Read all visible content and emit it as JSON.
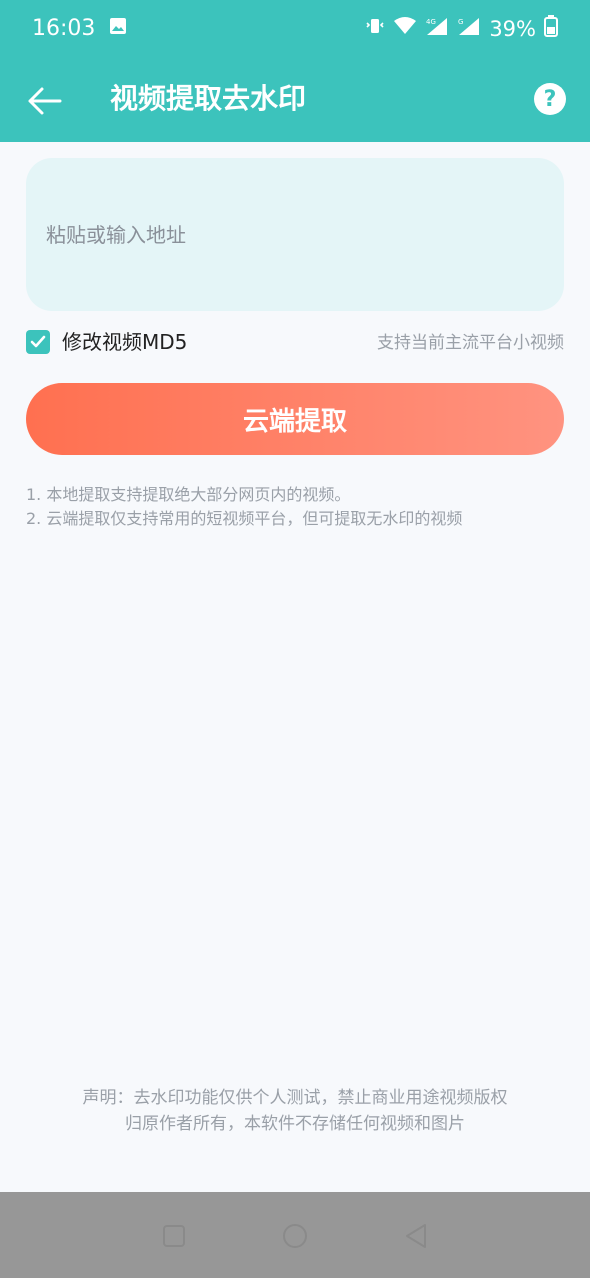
{
  "status_bar": {
    "time": "16:03",
    "battery": "39%",
    "icons": [
      "image-icon",
      "vibrate-icon",
      "wifi-icon",
      "signal-4g-icon",
      "signal-g-icon",
      "battery-icon"
    ]
  },
  "app_bar": {
    "title": "视频提取去水印",
    "help_label": "?"
  },
  "url_input": {
    "placeholder": "粘贴或输入地址",
    "value": ""
  },
  "options": {
    "md5_label": "修改视频MD5",
    "md5_checked": true,
    "supported_hint": "支持当前主流平台小视频"
  },
  "extract_button": {
    "label": "云端提取"
  },
  "notes": [
    "1. 本地提取支持提取绝大部分网页内的视频。",
    "2. 云端提取仅支持常用的短视频平台，但可提取无水印的视频"
  ],
  "disclaimer": {
    "line1": "声明：去水印功能仅供个人测试，禁止商业用途视频版权",
    "line2": "归原作者所有，本软件不存储任何视频和图片"
  },
  "colors": {
    "primary": "#3cc3bc",
    "button_start": "#ff7050",
    "button_end": "#ff9380",
    "input_bg": "#e4f5f7",
    "muted_text": "#9aa0a8"
  }
}
